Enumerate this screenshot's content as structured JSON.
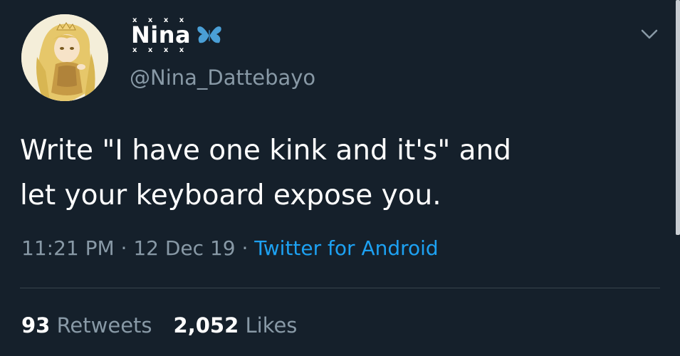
{
  "tweet": {
    "display_name": "Nina",
    "name_decoration": "x x x x",
    "name_emoji": "butterfly-icon",
    "handle": "@Nina_Dattebayo",
    "text_lines": [
      "Write \"I have one kink and it's\" and",
      "let your keyboard expose you."
    ],
    "time": "11:21 PM",
    "date": "12 Dec 19",
    "separator": " · ",
    "source": "Twitter for Android",
    "retweets_count": "93",
    "retweets_label": "Retweets",
    "likes_count": "2,052",
    "likes_label": "Likes"
  },
  "icons": {
    "menu": "chevron-down-icon",
    "avatar": "anime-girl-avatar"
  },
  "colors": {
    "background": "#15202b",
    "text_primary": "#ffffff",
    "text_secondary": "#8899a6",
    "link": "#1da1f2",
    "divider": "#38444d",
    "butterfly": "#4a9fd6"
  }
}
